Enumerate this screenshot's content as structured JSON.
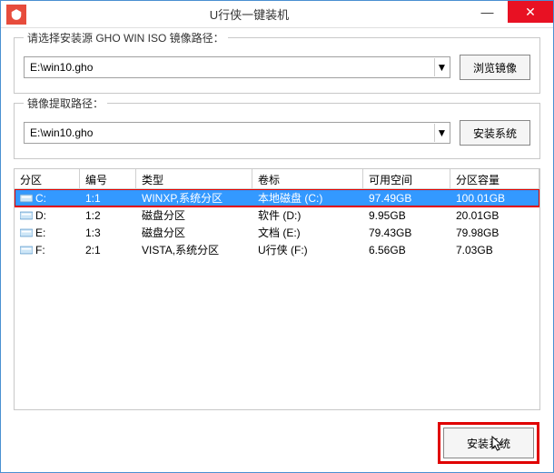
{
  "window": {
    "title": "U行侠一键装机"
  },
  "group1": {
    "label": "请选择安装源 GHO WIN ISO 镜像路径：",
    "value": "E:\\win10.gho",
    "browse_btn": "浏览镜像"
  },
  "group2": {
    "label": "镜像提取路径：",
    "value": "E:\\win10.gho",
    "install_btn": "安装系统"
  },
  "table": {
    "headers": {
      "partition": "分区",
      "number": "编号",
      "type": "类型",
      "volume": "卷标",
      "free": "可用空间",
      "capacity": "分区容量"
    },
    "rows": [
      {
        "part": "C:",
        "num": "1:1",
        "type": "WINXP,系统分区",
        "vol": "本地磁盘 (C:)",
        "free": "97.49GB",
        "cap": "100.01GB",
        "selected": true
      },
      {
        "part": "D:",
        "num": "1:2",
        "type": "磁盘分区",
        "vol": "软件 (D:)",
        "free": "9.95GB",
        "cap": "20.01GB",
        "selected": false
      },
      {
        "part": "E:",
        "num": "1:3",
        "type": "磁盘分区",
        "vol": "文档 (E:)",
        "free": "79.43GB",
        "cap": "79.98GB",
        "selected": false
      },
      {
        "part": "F:",
        "num": "2:1",
        "type": "VISTA,系统分区",
        "vol": "U行侠 (F:)",
        "free": "6.56GB",
        "cap": "7.03GB",
        "selected": false
      }
    ]
  },
  "footer": {
    "install_btn": "安装系统"
  },
  "icons": {
    "chevron_down": "▼"
  }
}
